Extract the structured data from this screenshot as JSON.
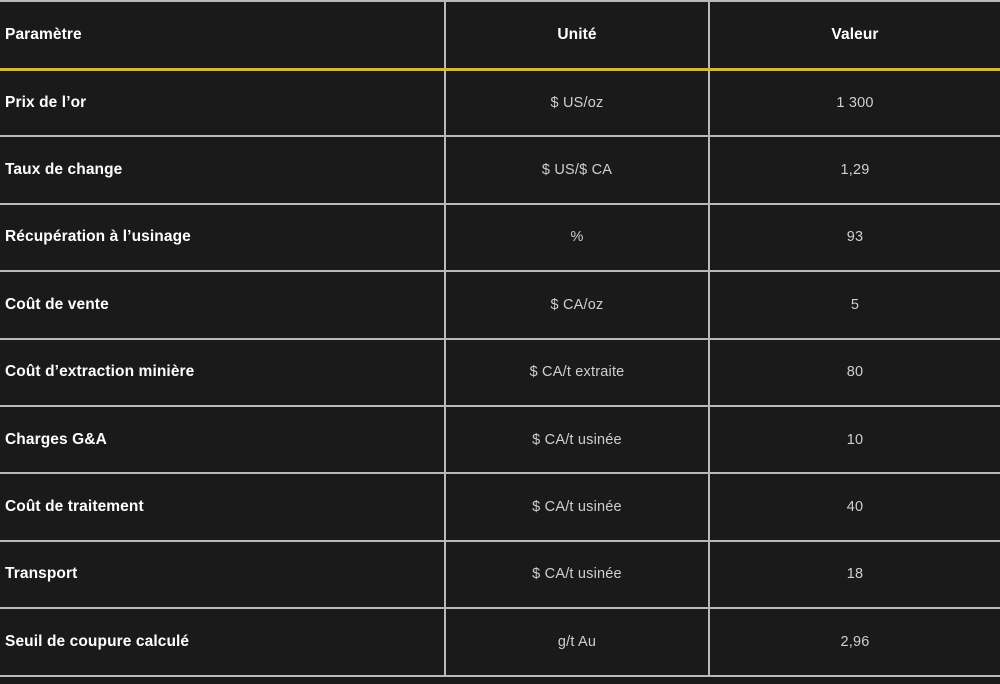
{
  "table": {
    "name": "parametres-economiques",
    "columns": [
      {
        "key": "parametre",
        "label": "Paramètre",
        "align": "left"
      },
      {
        "key": "unite",
        "label": "Unité",
        "align": "center"
      },
      {
        "key": "valeur",
        "label": "Valeur",
        "align": "center"
      }
    ],
    "header_rule_color": "#d4b83a",
    "grid_line_color": "#b9b9b9",
    "background_color": "#1a1a1a",
    "header_text_color": "#ffffff",
    "body_label_color": "#ffffff",
    "body_value_color": "#cfcfcf",
    "rows": [
      {
        "parametre": "Prix de l’or",
        "unite": "$ US/oz",
        "valeur": "1 300"
      },
      {
        "parametre": "Taux de change",
        "unite": "$ US/$ CA",
        "valeur": "1,29"
      },
      {
        "parametre": "Récupération à l’usinage",
        "unite": "%",
        "valeur": "93"
      },
      {
        "parametre": "Coût de vente",
        "unite": "$ CA/oz",
        "valeur": "5"
      },
      {
        "parametre": "Coût d’extraction minière",
        "unite": "$ CA/t extraite",
        "valeur": "80"
      },
      {
        "parametre": "Charges G&A",
        "unite": "$ CA/t usinée",
        "valeur": "10"
      },
      {
        "parametre": "Coût de traitement",
        "unite": "$ CA/t usinée",
        "valeur": "40"
      },
      {
        "parametre": "Transport",
        "unite": "$ CA/t usinée",
        "valeur": "18"
      },
      {
        "parametre": "Seuil de coupure calculé",
        "unite": "g/t Au",
        "valeur": "2,96"
      }
    ]
  }
}
